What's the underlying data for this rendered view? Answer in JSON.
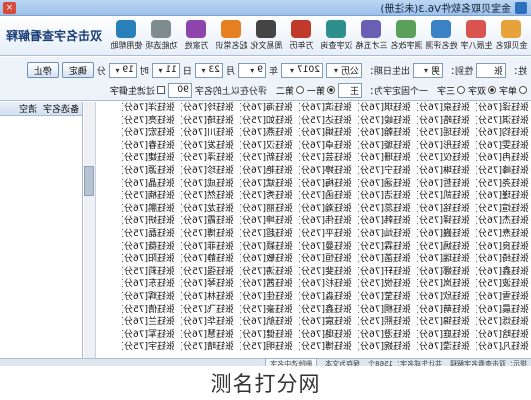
{
  "window": {
    "title": "金宝贝取名软件V6.3(未注册)",
    "close": "×"
  },
  "toolbar": {
    "brand": "双击名字查看解释",
    "tools": [
      {
        "label": "金贝取名",
        "icon": "baby-icon",
        "color": "#e8a23a"
      },
      {
        "label": "生辰八字",
        "icon": "calendar-icon",
        "color": "#d9534f"
      },
      {
        "label": "姓名评测",
        "icon": "chart-icon",
        "color": "#3b82c4"
      },
      {
        "label": "测字改名",
        "icon": "pen-icon",
        "color": "#5aa05a"
      },
      {
        "label": "三才五格",
        "icon": "grid-icon",
        "color": "#6b5fb5"
      },
      {
        "label": "汉字查询",
        "icon": "book-icon",
        "color": "#2f8f8f"
      },
      {
        "label": "万年历",
        "icon": "calendar-alt-icon",
        "color": "#c0392b"
      },
      {
        "label": "周易文化",
        "icon": "yinyang-icon",
        "color": "#444444"
      },
      {
        "label": "起名常识",
        "icon": "info-icon",
        "color": "#e67e22"
      },
      {
        "label": "万家姓",
        "icon": "people-icon",
        "color": "#8e44ad"
      },
      {
        "label": "功能选项",
        "icon": "gear-icon",
        "color": "#7f8c8d"
      },
      {
        "label": "使用帮助",
        "icon": "help-icon",
        "color": "#2980b9"
      }
    ]
  },
  "form": {
    "surname_label": "姓：",
    "surname_value": "张",
    "gender_label": "性别：",
    "gender_value": "男",
    "birth_label": "出生日期：",
    "calendar_value": "公历",
    "year_value": "2017",
    "year_unit": "年",
    "month_value": "9",
    "month_unit": "月",
    "day_value": "23",
    "day_unit": "日",
    "hour_value": "11",
    "hour_unit": "时",
    "minute_value": "19",
    "minute_unit": "分",
    "confirm_button": "确定",
    "stop_button": "停止",
    "radios": [
      "单字",
      "双字",
      "三字"
    ],
    "radio_selected": "双字",
    "fixed_label": "一个固定字为：",
    "fixed_value": "王",
    "position_first": "第一",
    "position_second": "第二",
    "score_label": "评分在以上的名字",
    "score_value": "90",
    "filter_label": "过滤生僻字"
  },
  "names": [
    [
      "张钰译[76分]",
      "张钰淇[75分]",
      "张钰钧[76分]",
      "张钰雯[76分]",
      "张钰冉[76分]",
      "张钰峰[75分]",
      "张钰尧[75分]",
      "张钰瑾[76分]",
      "张钰煊[75分]",
      "张钰杰[76分]",
      "张钰焘[75分]",
      "张钰良[76分]",
      "张钰绮[76分]",
      "张钰鑫[76分]",
      "张钰波[75分]",
      "张钰雪[76分]",
      "张钰晨[76分]",
      "张钰烁[75分]",
      "张钰晗[76分]",
      "张钰凡[76分]"
    ],
    [
      "张钰泉[76分]",
      "张钰皓[76分]",
      "张钰瑶[75分]",
      "张钰彤[76分]",
      "张钰仪[75分]",
      "张钰琳[76分]",
      "张钰哲[76分]",
      "张钰凯[75分]",
      "张钰铭[76分]",
      "张钰铎[75分]",
      "张钰巍[76分]",
      "张钰嫣[75分]",
      "张钰瑞[76分]",
      "张钰娜[76分]",
      "张钰岚[75分]",
      "张钰欣[76分]",
      "张钰萌[76分]",
      "张钰锦[75分]",
      "张钰庭[76分]",
      "张钰滢[76分]"
    ],
    [
      "张钰琪[76分]",
      "张钰峻[75分]",
      "张钰翰[76分]",
      "张钰璇[76分]",
      "张钰珊[76分]",
      "张钰宁[75分]",
      "张钰涵[76分]",
      "张钰洁[76分]",
      "张钰蕊[75分]",
      "张钰韩[76分]",
      "张钰灿[76分]",
      "张钰霖[75分]",
      "张钰菡[76分]",
      "张钰轩[76分]",
      "张钰悦[75分]",
      "张钰莹[76分]",
      "张钰桐[76分]",
      "张钰熙[75分]",
      "张钰澄[76分]",
      "张钰婉[76分]"
    ],
    [
      "张钰滨[76分]",
      "张钰达[75分]",
      "张钰娟[76分]",
      "张钰卓[76分]",
      "张钰芸[75分]",
      "张钰婷[76分]",
      "张钰梅[76分]",
      "张钰函[75分]",
      "张钰瀚[76分]",
      "张钰伟[76分]",
      "张钰平[75分]",
      "张钰曼[76分]",
      "张钰恒[76分]",
      "张钰斐[75分]",
      "张钰杉[76分]",
      "张钰淼[76分]",
      "张钰鑫[75分]",
      "张钰宸[76分]",
      "张钰璐[76分]",
      "张钰博[75分]"
    ],
    [
      "张钰海[76分]",
      "张钰如[75分]",
      "张钰燕[76分]",
      "张钰汉[76分]",
      "张钰新[75分]",
      "张钰艳[76分]",
      "张钰斌[76分]",
      "张钰秀[75分]",
      "张钰丽[76分]",
      "张钰坤[76分]",
      "张钰超[75分]",
      "张钰颖[76分]",
      "张钰敏[76分]",
      "张钰涛[75分]",
      "张钰茜[76分]",
      "张钰佳[76分]",
      "张钰豪[75分]",
      "张钰航[76分]",
      "张钰健[76分]",
      "张钰明[75分]"
    ],
    [
      "张钰玲[76分]",
      "张钰琦[75分]",
      "张钰川[76分]",
      "张钰发[76分]",
      "张钰泽[75分]",
      "张钰珍[76分]",
      "张钰成[76分]",
      "张钰然[75分]",
      "张钰龙[76分]",
      "张钰霞[76分]",
      "张钰博[75分]",
      "张钰菲[76分]",
      "张钰静[76分]",
      "张钰强[75分]",
      "张钰琴[76分]",
      "张钰林[76分]",
      "张钰飞[75分]",
      "张钰华[76分]",
      "张钰慧[76分]",
      "张钰晴[75分]"
    ],
    [
      "张钰洋[76分]",
      "张钰亮[75分]",
      "张钰宏[76分]",
      "张钰春[76分]",
      "张钰婕[75分]",
      "张钰源[76分]",
      "张钰晶[76分]",
      "张钰楠[75分]",
      "张钰鹏[76分]",
      "张钰妍[76分]",
      "张钰磊[75分]",
      "张钰薇[76分]",
      "张钰阳[76分]",
      "张钰莉[75分]",
      "张钰东[76分]",
      "张钰辉[76分]",
      "张钰倩[75分]",
      "张钰兰[76分]",
      "张钰军[76分]",
      "张钰宇[75分]"
    ]
  ],
  "favorites": {
    "title": "备选名字",
    "clear": "清空"
  },
  "status": {
    "left": "提示：双击查看名字解释",
    "middle": "共计生成名字：1568个",
    "right": "保存为文本",
    "button": "删除选中名字"
  },
  "watermark": "测名打分网"
}
